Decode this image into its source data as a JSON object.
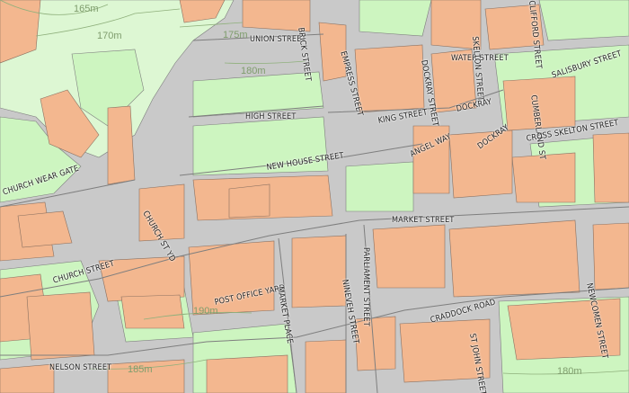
{
  "map": {
    "colors": {
      "road": "#c9c9c9",
      "building": "#f3b78f",
      "green": "#cdf5c0",
      "edge": "#7e7e7e",
      "contour": "#8fb07c"
    },
    "street_labels": [
      "UNION STREET",
      "BRICK STREET",
      "EMPRESS STREET",
      "DOCKRAY STREET",
      "WATER STREET",
      "SKELTON STREET",
      "CLIFFORD STREET",
      "SALISBURY STREET",
      "HIGH STREET",
      "KING STREET",
      "DOCKRAY",
      "CUMBERLAND ST",
      "CROSS SKELTON STREET",
      "NEW HOUSE STREET",
      "ANGEL WAY",
      "DOCKRAY",
      "CHURCH WEAR GATE",
      "CHURCH ST YD",
      "MARKET STREET",
      "CHURCH STREET",
      "PARLIAMENT STREET",
      "POST OFFICE YARD",
      "MARKET PLACE",
      "NINEVEH STREET",
      "CRADDOCK ROAD",
      "ST JOHN STREET",
      "NEWCOMEN STREET",
      "NELSON STREET"
    ],
    "contour_labels": [
      "165m",
      "170m",
      "175m",
      "180m",
      "190m",
      "185m",
      "180m"
    ]
  }
}
